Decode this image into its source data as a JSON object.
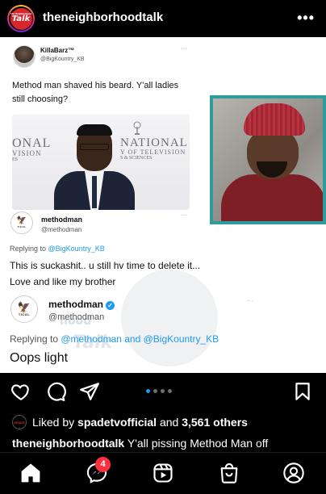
{
  "header": {
    "username": "theneighborhoodtalk",
    "avatar_text_top": "The Neighborhood",
    "avatar_text_main": "Talk",
    "more_label": "•••"
  },
  "tweet": {
    "author_name": "KillaBarz™",
    "author_handle": "@BigKountry_KB",
    "more": "···",
    "text": "Method man shaved his beard. Y'all ladies still choosing?",
    "photo_text_left": [
      "ONAL",
      "VISION",
      "ES"
    ],
    "photo_text_right": [
      "NATIONAL",
      "Y OF TELEVISION",
      "S & SCIENCES"
    ]
  },
  "reply1": {
    "avatar_label": "TICAL",
    "name": "methodman",
    "handle": "@methodman",
    "more": "···",
    "replying_prefix": "Replying to ",
    "replying_mention": "@BigKountry_KB",
    "text": "This is suckashit.. u still hv time to delete it... Love and like my brother"
  },
  "reply2": {
    "avatar_label": "TICAL",
    "name": "methodman",
    "verified": "✓",
    "handle": "@methodman",
    "more": "···",
    "replying_prefix": "Replying to ",
    "replying_mention": "@methodman and @BigKountry_KB",
    "text": "Oops light"
  },
  "watermark": {
    "line1": "hood",
    "line2": "Talk"
  },
  "actions": {
    "like_icon": "heart-icon",
    "comment_icon": "comment-icon",
    "share_icon": "send-icon",
    "save_icon": "bookmark-icon",
    "carousel_total": 4,
    "carousel_active": 1
  },
  "likes": {
    "avatar_label": "SPADE",
    "prefix": "Liked by ",
    "user": "spadetvofficial",
    "middle": " and ",
    "count": "3,561 others"
  },
  "caption": {
    "user": "theneighborhoodtalk",
    "text": " Y'all pissing Method Man off"
  },
  "nav": {
    "items": [
      "home-icon",
      "messenger-icon",
      "reels-icon",
      "shop-icon",
      "profile-icon"
    ],
    "badge": "4"
  },
  "colors": {
    "accent": "#1d9bf0",
    "badge": "#ff3040",
    "brand_red": "#d8262d"
  }
}
